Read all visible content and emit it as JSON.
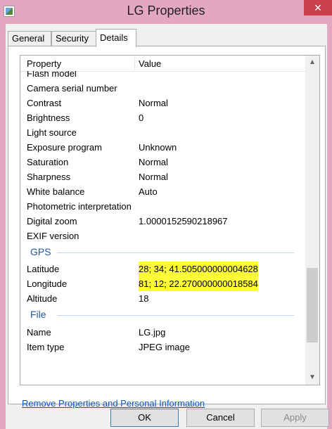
{
  "window": {
    "title": "LG Properties",
    "close_glyph": "✕"
  },
  "tabs": [
    {
      "label": "General"
    },
    {
      "label": "Security"
    },
    {
      "label": "Details"
    }
  ],
  "list": {
    "header": {
      "property": "Property",
      "value": "Value"
    },
    "rows": [
      {
        "p": "Flash model",
        "v": ""
      },
      {
        "p": "Camera serial number",
        "v": ""
      },
      {
        "p": "Contrast",
        "v": "Normal"
      },
      {
        "p": "Brightness",
        "v": "0"
      },
      {
        "p": "Light source",
        "v": ""
      },
      {
        "p": "Exposure program",
        "v": "Unknown"
      },
      {
        "p": "Saturation",
        "v": "Normal"
      },
      {
        "p": "Sharpness",
        "v": "Normal"
      },
      {
        "p": "White balance",
        "v": "Auto"
      },
      {
        "p": "Photometric interpretation",
        "v": ""
      },
      {
        "p": "Digital zoom",
        "v": "1.0000152590218967"
      },
      {
        "p": "EXIF version",
        "v": ""
      }
    ],
    "gps_group": "GPS",
    "gps_rows": [
      {
        "p": "Latitude",
        "v": "28; 34; 41.505000000004628"
      },
      {
        "p": "Longitude",
        "v": "81; 12; 22.270000000018584"
      },
      {
        "p": "Altitude",
        "v": "18"
      }
    ],
    "file_group": "File",
    "file_rows": [
      {
        "p": "Name",
        "v": "LG.jpg"
      },
      {
        "p": "Item type",
        "v": "JPEG image"
      }
    ],
    "highlight_color": "#fdfa38"
  },
  "scroll": {
    "up": "▲",
    "down": "▼"
  },
  "remove_link": "Remove Properties and Personal Information",
  "buttons": {
    "ok": "OK",
    "cancel": "Cancel",
    "apply": "Apply"
  }
}
